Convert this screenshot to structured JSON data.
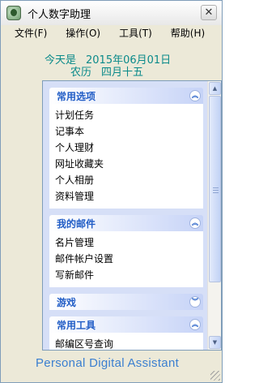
{
  "window": {
    "title": "个人数字助理",
    "close_glyph": "✕"
  },
  "menu": [
    "文件(F)",
    "操作(O)",
    "工具(T)",
    "帮助(H)"
  ],
  "date": {
    "today_label": "今天是",
    "today_value": "2015年06月01日",
    "lunar_label": "农历",
    "lunar_value": "四月十五"
  },
  "groups": [
    {
      "title": "常用选项",
      "state": "expanded",
      "items": [
        "计划任务",
        "记事本",
        "个人理财",
        "网址收藏夹",
        "个人相册",
        "资料管理"
      ]
    },
    {
      "title": "我的邮件",
      "state": "expanded",
      "items": [
        "名片管理",
        "邮件帐户设置",
        "写新邮件"
      ]
    },
    {
      "title": "游戏",
      "state": "collapsed",
      "items": []
    },
    {
      "title": "常用工具",
      "state": "expanded",
      "items": [
        "邮编区号查询"
      ]
    }
  ],
  "footer": {
    "label": "Personal Digital Assistant"
  },
  "colors": {
    "date_text": "#0a8a8a",
    "group_title": "#215dc6",
    "footer_text": "#3b7fd0",
    "window_bg": "#ECE9D8"
  },
  "icons": {
    "app": "app-icon",
    "expanded": "chevron-up-double-icon",
    "collapsed": "chevron-down-double-icon"
  }
}
